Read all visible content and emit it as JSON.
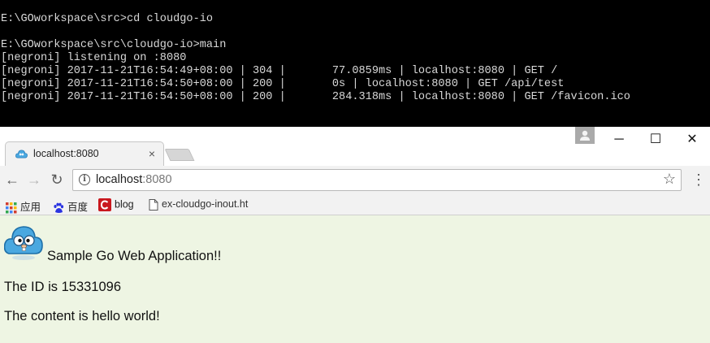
{
  "terminal": {
    "lines": [
      "E:\\GOworkspace\\src>cd cloudgo-io",
      "",
      "E:\\GOworkspace\\src\\cloudgo-io>main",
      "[negroni] listening on :8080",
      "[negroni] 2017-11-21T16:54:49+08:00 | 304 |       77.0859ms | localhost:8080 | GET /",
      "[negroni] 2017-11-21T16:54:50+08:00 | 200 |       0s | localhost:8080 | GET /api/test",
      "[negroni] 2017-11-21T16:54:50+08:00 | 200 |       284.318ms | localhost:8080 | GET /favicon.ico"
    ]
  },
  "browser": {
    "tab": {
      "title": "localhost:8080",
      "close": "×",
      "favicon": "cloud-gopher-icon"
    },
    "window_controls": {
      "minimize": "─",
      "maximize": "☐",
      "close": "✕"
    },
    "toolbar": {
      "back": "←",
      "forward": "→",
      "reload": "↻",
      "menu": "⋮",
      "star": "☆",
      "info": "i"
    },
    "omnibox": {
      "host": "localhost",
      "port": ":8080"
    },
    "bookmarks": [
      {
        "label": "应用",
        "icon": "apps-grid-icon"
      },
      {
        "label": "百度",
        "icon": "baidu-paw-icon"
      },
      {
        "label": "blog",
        "icon": "csdn-c-icon"
      },
      {
        "label": "ex-cloudgo-inout.ht",
        "icon": "file-icon"
      }
    ]
  },
  "page": {
    "heading": "Sample Go Web Application!!",
    "id_line": "The ID is 15331096",
    "content_line": "The content is hello world!"
  },
  "colors": {
    "page_background": "#eef5e3",
    "terminal_background": "#000000",
    "terminal_text": "#d8d8d8",
    "cloud_logo": "#4aa8e0"
  }
}
